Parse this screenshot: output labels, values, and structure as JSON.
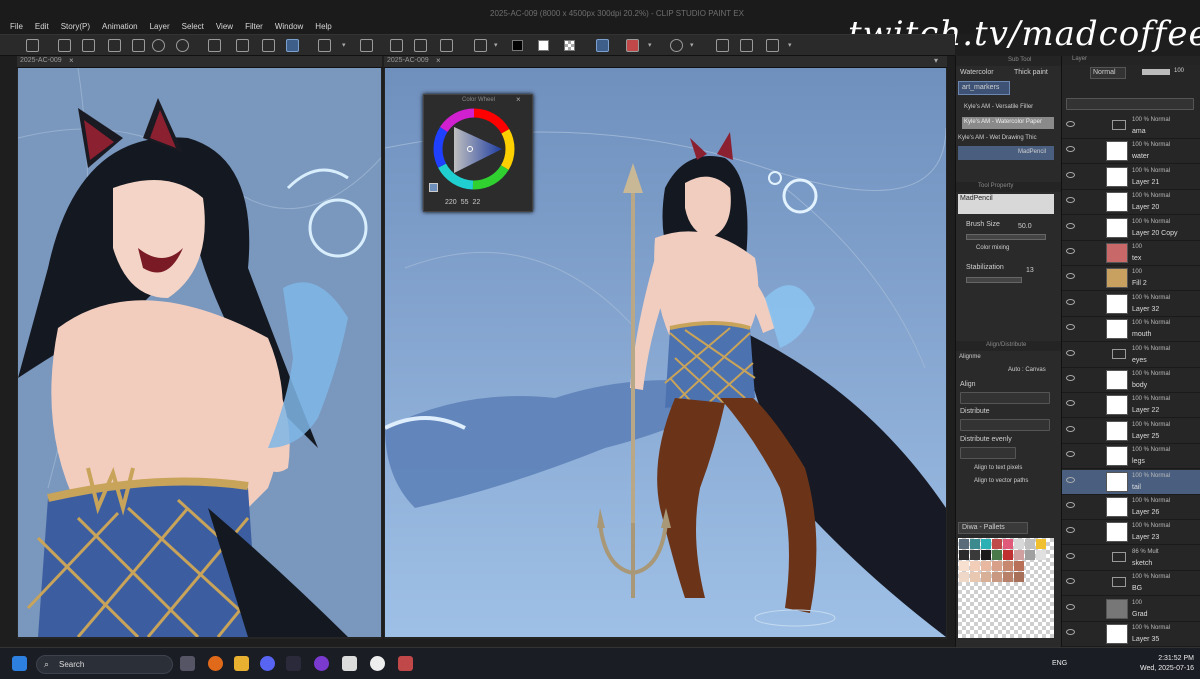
{
  "app": {
    "title": "2025-AC-009 (8000 x 4500px 300dpi 20.2%) - CLIP STUDIO PAINT EX",
    "menu": [
      "File",
      "Edit",
      "Story(P)",
      "Animation",
      "Layer",
      "Select",
      "View",
      "Filter",
      "Window",
      "Help"
    ],
    "watermark": "twitch.tv/madcoffee"
  },
  "documents": {
    "left_tab": "2025-AC-009",
    "right_tab": "2025-AC-009"
  },
  "color_wheel": {
    "title": "Color Wheel",
    "values": [
      "220",
      "55",
      "22"
    ]
  },
  "sub_tool": {
    "title": "Sub Tool",
    "tabs": [
      "Watercolor",
      "Thick paint"
    ],
    "group": "art_markers",
    "brushes": [
      "Kyle's AM - Versatile Filler",
      "Kyle's AM - Watercolor Paper",
      "Kyle's AM - Wet Drawing Thic"
    ],
    "selected_brush": "MadPencil"
  },
  "tool_property": {
    "title": "Tool Property",
    "brush_name": "MadPencil",
    "brush_size_label": "Brush Size",
    "brush_size_value": "50.0",
    "color_mixing_label": "Color mixing",
    "stabilization_label": "Stabilization",
    "stabilization_value": "13"
  },
  "align": {
    "title": "Align/Distribute",
    "alignment_label": "Alignme",
    "target": "Auto : Canvas",
    "align_label": "Align",
    "distribute_label": "Distribute",
    "distribute_evenly_label": "Distribute evenly",
    "option1": "Align to text pixels",
    "option2": "Align to vector paths"
  },
  "palette": {
    "name": "Diwa - Pallets",
    "colors": [
      "#5a6b7a",
      "#3c8a8e",
      "#2ab0b5",
      "#c04a4a",
      "#e05a7a",
      "#d8d8d8",
      "#c0c0c0",
      "#f0c030",
      "#2a2a2a",
      "#3a3a3a",
      "#1a1a1a",
      "#4a7a4a",
      "#c03030",
      "#d0a0a0",
      "#a0a0a0",
      "#e0e0e0"
    ],
    "skin": [
      "#f7e0d0",
      "#f2cdb8",
      "#e8b8a0",
      "#d8a088",
      "#c88870",
      "#b87058",
      "#f0d8c8",
      "#e8c8b0",
      "#d8b098",
      "#c89880",
      "#b88068",
      "#a87058"
    ]
  },
  "layer_panel": {
    "title": "Layer",
    "blend_mode": "Normal",
    "opacity": "100",
    "layers": [
      {
        "pct": "100 % Normal",
        "name": "ama",
        "kind": "folder"
      },
      {
        "pct": "100 % Normal",
        "name": "water"
      },
      {
        "pct": "100 % Normal",
        "name": "Layer 21"
      },
      {
        "pct": "100 % Normal",
        "name": "Layer 20"
      },
      {
        "pct": "100 % Normal",
        "name": "Layer 20 Copy"
      },
      {
        "pct": "100",
        "name": "tex"
      },
      {
        "pct": "100",
        "name": "Fill 2"
      },
      {
        "pct": "100 % Normal",
        "name": "Layer 32"
      },
      {
        "pct": "100 % Normal",
        "name": "mouth"
      },
      {
        "pct": "100 % Normal",
        "name": "eyes",
        "kind": "folder"
      },
      {
        "pct": "100 % Normal",
        "name": "body"
      },
      {
        "pct": "100 % Normal",
        "name": "Layer 22"
      },
      {
        "pct": "100 % Normal",
        "name": "Layer 25"
      },
      {
        "pct": "100 % Normal",
        "name": "legs"
      },
      {
        "pct": "100 % Normal",
        "name": "tail",
        "selected": true
      },
      {
        "pct": "100 % Normal",
        "name": "Layer 26"
      },
      {
        "pct": "100 % Normal",
        "name": "Layer 23"
      },
      {
        "pct": "86 % Mult",
        "name": "sketch",
        "kind": "folder"
      },
      {
        "pct": "100 % Normal",
        "name": "BG",
        "kind": "folder"
      },
      {
        "pct": "100",
        "name": "Grad"
      },
      {
        "pct": "100 % Normal",
        "name": "Layer 35"
      }
    ]
  },
  "taskbar": {
    "search_placeholder": "Search",
    "lang": "ENG",
    "time": "2:31:52 PM",
    "date": "Wed, 2025-07-16"
  }
}
